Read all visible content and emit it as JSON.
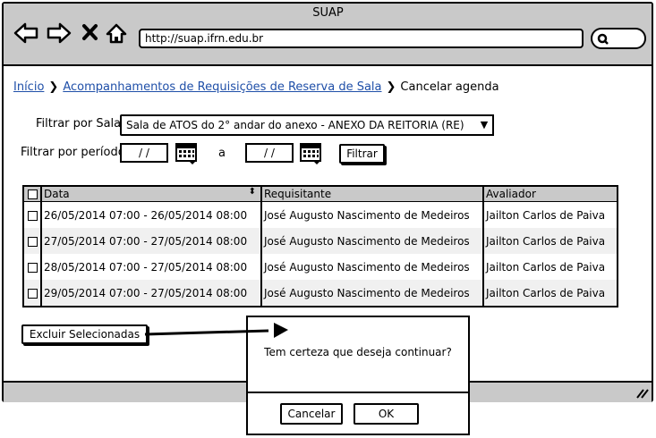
{
  "browser": {
    "title": "SUAP",
    "url": "http://suap.ifrn.edu.br"
  },
  "breadcrumb": {
    "home": "Início",
    "section": "Acompanhamentos de Requisições de Reserva de Sala",
    "current": "Cancelar agenda"
  },
  "filters": {
    "room_label": "Filtrar por Sala:",
    "room_value": "Sala de ATOS do 2° andar do anexo - ANEXO DA REITORIA (RE)",
    "period_label": "Filtrar por período:",
    "date_from": "/ /",
    "to_label": "a",
    "date_to": "/ /",
    "filter_button": "Filtrar"
  },
  "table": {
    "columns": [
      "Data",
      "Requisitante",
      "Avaliador"
    ],
    "rows": [
      {
        "date": "26/05/2014 07:00 - 26/05/2014 08:00",
        "requester": "José Augusto Nascimento de Medeiros",
        "evaluator": "Jailton Carlos de Paiva"
      },
      {
        "date": "27/05/2014 07:00 - 27/05/2014 08:00",
        "requester": "José Augusto Nascimento de Medeiros",
        "evaluator": "Jailton Carlos de Paiva"
      },
      {
        "date": "28/05/2014 07:00 - 27/05/2014 08:00",
        "requester": "José Augusto Nascimento de Medeiros",
        "evaluator": "Jailton Carlos de Paiva"
      },
      {
        "date": "29/05/2014 07:00 - 27/05/2014 08:00",
        "requester": "José Augusto Nascimento de Medeiros",
        "evaluator": "Jailton Carlos de Paiva"
      }
    ]
  },
  "actions": {
    "delete_selected": "Excluir Selecionadas"
  },
  "dialog": {
    "message": "Tem certeza que deseja continuar?",
    "cancel": "Cancelar",
    "ok": "OK"
  }
}
